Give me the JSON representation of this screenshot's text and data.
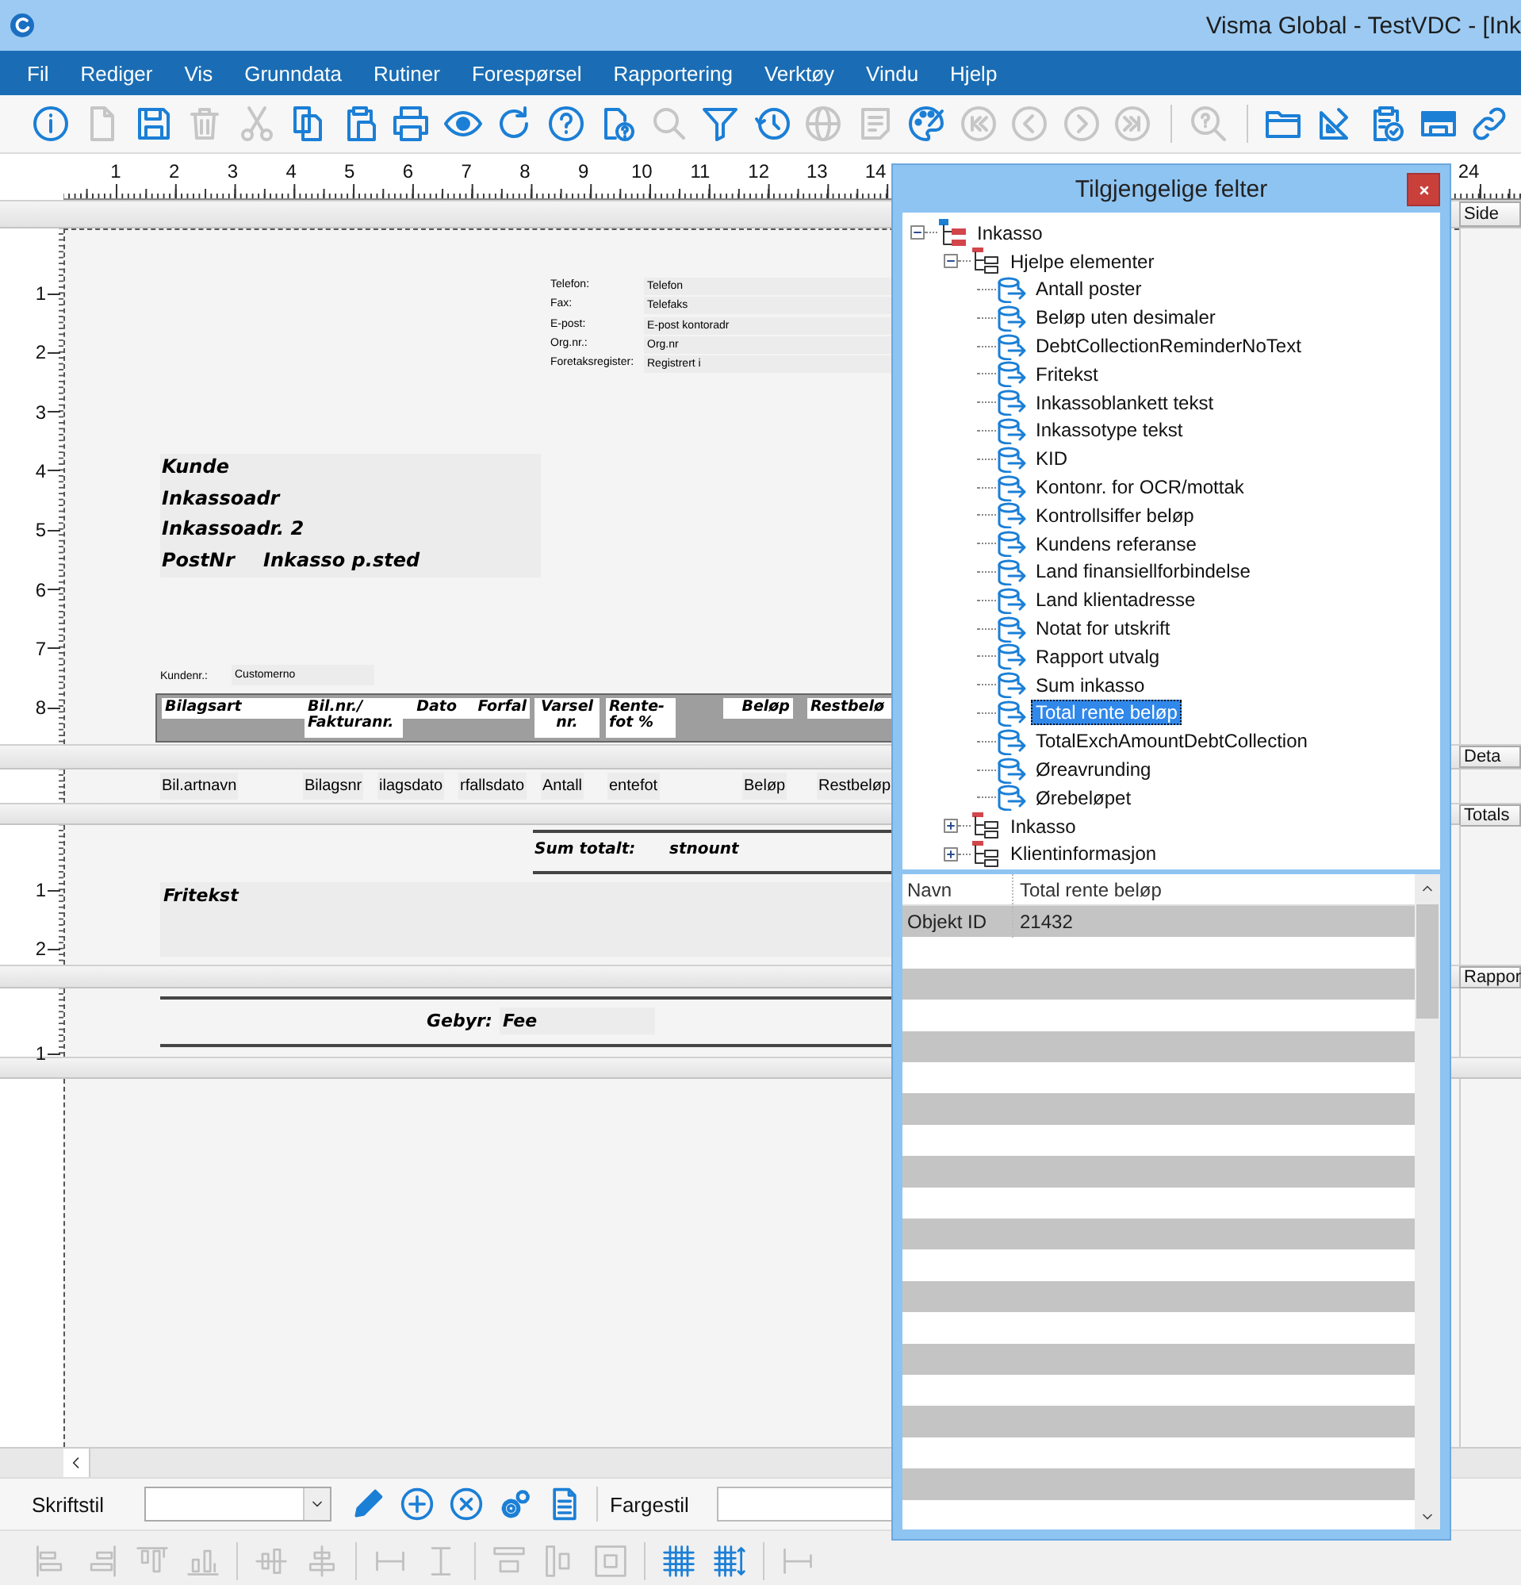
{
  "window": {
    "title": "Visma Global - TestVDC - [Ink"
  },
  "menu": [
    "Fil",
    "Rediger",
    "Vis",
    "Grunndata",
    "Rutiner",
    "Forespørsel",
    "Rapportering",
    "Verktøy",
    "Vindu",
    "Hjelp"
  ],
  "toolbar": [
    {
      "disabled": false
    },
    {
      "disabled": true
    },
    {
      "disabled": false
    },
    {
      "disabled": true
    },
    {
      "disabled": true
    },
    {
      "disabled": false
    },
    {
      "disabled": false
    },
    {
      "disabled": false
    },
    {
      "disabled": false
    },
    {
      "disabled": false
    },
    {
      "disabled": false
    },
    {
      "disabled": false
    },
    {
      "disabled": true
    },
    {
      "disabled": false
    },
    {
      "disabled": false
    },
    {
      "disabled": true
    },
    {
      "disabled": true
    },
    {
      "disabled": false
    },
    {
      "disabled": true
    },
    {
      "disabled": true
    },
    {
      "disabled": true
    },
    {
      "disabled": true
    },
    {
      "disabled": true
    },
    {
      "disabled": false
    },
    {
      "disabled": false
    },
    {
      "disabled": false
    },
    {
      "disabled": false
    },
    {
      "disabled": false
    }
  ],
  "top_ruler": {
    "labels": [
      "1",
      "2",
      "3",
      "4",
      "5",
      "6",
      "7",
      "8",
      "9",
      "10",
      "11",
      "12",
      "13",
      "14"
    ],
    "end_label": "24"
  },
  "report_bands": [
    {
      "kind": "page_header",
      "header": "Side",
      "ruler": [
        "1",
        "2",
        "3",
        "4",
        "5",
        "6",
        "7",
        "8"
      ],
      "contact": [
        {
          "label": "Telefon:",
          "value": "Telefon"
        },
        {
          "label": "Fax:",
          "value": "Telefaks"
        },
        {
          "label": "E-post:",
          "value": "E-post kontoradr"
        },
        {
          "label": "Org.nr.:",
          "value": "Org.nr"
        },
        {
          "label": "Foretaksregister:",
          "value": "Registrert i"
        }
      ],
      "address": [
        "Kunde",
        "Inkassoadr",
        "Inkassoadr. 2"
      ],
      "postal": {
        "code": "PostNr",
        "city": "Inkasso p.sted"
      },
      "customer_no": {
        "label": "Kundenr.:",
        "value": "Customerno"
      },
      "table_header": [
        "Bilagsart",
        "Bil.nr./\nFakturanr.",
        "Dato",
        "Forfal",
        "Varsel\nnr.",
        "Rente-\nfot %",
        "Beløp",
        "Restbelø"
      ]
    },
    {
      "kind": "detail",
      "header": "Deta",
      "fields": [
        "Bil.artnavn",
        "Bilagsnr",
        "ilagsdato",
        "rfallsdato",
        "Antall",
        "entefot",
        "Beløp",
        "Restbeløp"
      ]
    },
    {
      "kind": "totals",
      "header": "Totals",
      "ruler": [
        "1",
        "2"
      ],
      "sum": {
        "label": "Sum totalt:",
        "value": "stnount"
      },
      "free_text": "Fritekst"
    },
    {
      "kind": "report_footer",
      "header": "Rappor",
      "ruler": [
        "1"
      ],
      "fee": {
        "label": "Gebyr:",
        "value": "Fee"
      }
    }
  ],
  "dialog": {
    "title": "Tilgjengelige felter",
    "tree": [
      {
        "label": "Inkasso",
        "kind": "root",
        "expanded": true,
        "selected": false,
        "children": [
          {
            "label": "Hjelpe elementer",
            "kind": "group",
            "expanded": true,
            "selected": false,
            "children": [
              {
                "label": "Antall poster",
                "kind": "field",
                "selected": false
              },
              {
                "label": "Beløp uten desimaler",
                "kind": "field",
                "selected": false
              },
              {
                "label": "DebtCollectionReminderNoText",
                "kind": "field",
                "selected": false
              },
              {
                "label": "Fritekst",
                "kind": "field",
                "selected": false
              },
              {
                "label": "Inkassoblankett tekst",
                "kind": "field",
                "selected": false
              },
              {
                "label": "Inkassotype tekst",
                "kind": "field",
                "selected": false
              },
              {
                "label": "KID",
                "kind": "field",
                "selected": false
              },
              {
                "label": "Kontonr. for OCR/mottak",
                "kind": "field",
                "selected": false
              },
              {
                "label": "Kontrollsiffer beløp",
                "kind": "field",
                "selected": false
              },
              {
                "label": "Kundens referanse",
                "kind": "field",
                "selected": false
              },
              {
                "label": "Land finansiellforbindelse",
                "kind": "field",
                "selected": false
              },
              {
                "label": "Land klientadresse",
                "kind": "field",
                "selected": false
              },
              {
                "label": "Notat for utskrift",
                "kind": "field",
                "selected": false
              },
              {
                "label": "Rapport utvalg",
                "kind": "field",
                "selected": false
              },
              {
                "label": "Sum inkasso",
                "kind": "field",
                "selected": false
              },
              {
                "label": "Total rente beløp",
                "kind": "field",
                "selected": true
              },
              {
                "label": "TotalExchAmountDebtCollection",
                "kind": "field",
                "selected": false
              },
              {
                "label": "Øreavrunding",
                "kind": "field",
                "selected": false
              },
              {
                "label": "Ørebeløpet",
                "kind": "field",
                "selected": false
              }
            ]
          },
          {
            "label": "Inkasso",
            "kind": "group",
            "expanded": false,
            "selected": false
          },
          {
            "label": "Klientinformasjon",
            "kind": "group",
            "expanded": false,
            "selected": false
          }
        ]
      }
    ],
    "grid": {
      "columns": [
        "Navn",
        "Total rente beløp"
      ],
      "rows": [
        [
          "Objekt ID",
          "21432"
        ]
      ]
    }
  },
  "property_bar": {
    "font_style_label": "Skriftstil",
    "color_style_label": "Fargestil"
  },
  "align_tools": [
    {
      "disabled": true
    },
    {
      "disabled": true
    },
    {
      "disabled": true
    },
    {
      "disabled": true
    },
    {
      "disabled": true
    },
    {
      "disabled": true
    },
    {
      "disabled": true
    },
    {
      "disabled": true
    },
    {
      "disabled": true
    },
    {
      "disabled": true
    },
    {
      "disabled": true
    },
    {
      "disabled": false
    },
    {
      "disabled": false
    },
    {
      "disabled": true
    }
  ]
}
